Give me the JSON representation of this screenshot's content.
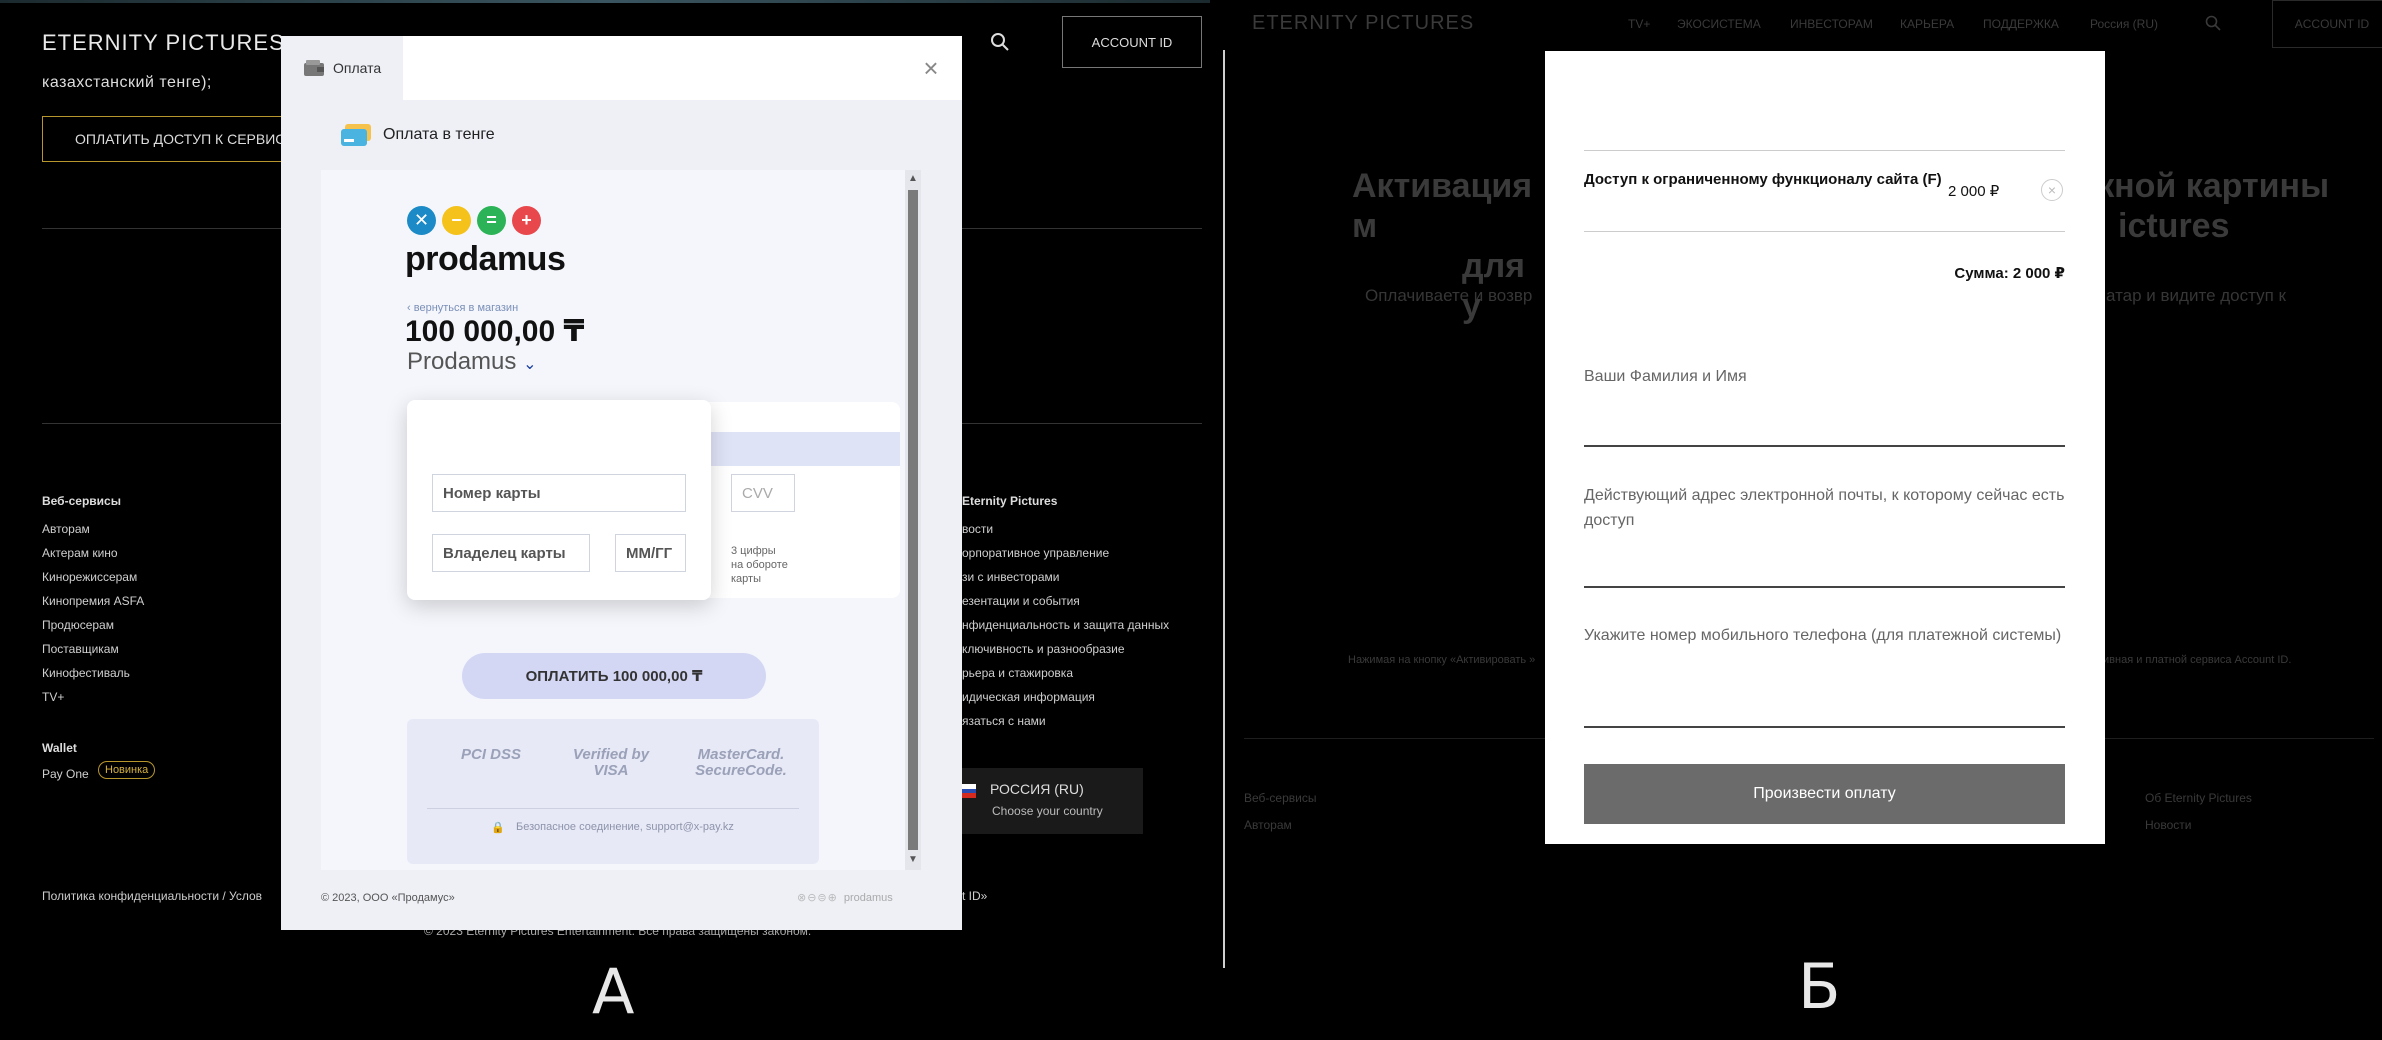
{
  "panel_a": {
    "site_logo": "ETERNITY PICTURES",
    "account_button": "ACCOUNT ID",
    "kzt_text": "казахстанский тенге);",
    "pay_access_button": "ОПЛАТИТЬ ДОСТУП К СЕРВИС",
    "footer": {
      "web_services_heading": "Веб-сервисы",
      "web_services": [
        "Авторам",
        "Актерам кино",
        "Кинорежиссерам",
        "Кинопремия ASFA",
        "Продюсерам",
        "Поставщикам",
        "Кинофестиваль",
        "TV+"
      ],
      "wallet_heading": "Wallet",
      "wallet_item": "Pay One",
      "wallet_badge": "Новинка",
      "about_heading": "Eternity Pictures",
      "about_links": [
        "вости",
        "орпоративное управление",
        "зи с инвесторами",
        "езентации и события",
        "нфиденциальность и защита данных",
        "ключивность и разнообразие",
        "рьера и стажировка",
        "идическая информация",
        "язаться с нами"
      ],
      "country_name": "РОССИЯ (RU)",
      "country_choose": "Choose your country",
      "policy": "Политика конфиденциальности   /   Услов",
      "policy_tail": "t ID»",
      "copyright": "© 2023 Eternity Pictures Entertainment. Все права защищены законом."
    },
    "letter": "А"
  },
  "modal_a": {
    "tab_label": "Оплата",
    "pay_in_tenge": "Оплата в тенге",
    "brand": "prodamus",
    "back_link": "вернуться в магазин",
    "amount": "100 000,00 ₸",
    "shop_name": "Prodamus",
    "card_number_placeholder": "Номер карты",
    "card_holder_placeholder": "Владелец карты",
    "expiry_placeholder": "ММ/ГГ",
    "cvv_placeholder": "CVV",
    "cvv_hint": [
      "3 цифры",
      "на обороте",
      "карты"
    ],
    "pay_button": "ОПЛАТИТЬ 100 000,00 ₸",
    "security_logos": [
      "PCI DSS",
      "Verified by VISA",
      "MasterCard. SecureCode."
    ],
    "secure_text": "Безопасное соединение, support@x-pay.kz",
    "footer_left": "© 2023, ООО «Продамус»",
    "footer_right": "prodamus"
  },
  "panel_b": {
    "site_logo": "ETERNITY PICTURES",
    "nav": [
      "TV+",
      "ЭКОСИСТЕМА",
      "ИНВЕСТОРАМ",
      "КАРЬЕРА",
      "ПОДДЕРЖКА",
      "Россия (RU)"
    ],
    "account_button": "ACCOUNT ID",
    "bg_title_left": [
      "Активация м",
      "для у"
    ],
    "bg_title_right": [
      "жной картины",
      "ictures"
    ],
    "bg_text_left": "Оплачиваете и возвр",
    "bg_text_right": "атар и видите доступ к",
    "bg_small_left": "Нажимая на кнопку «Активировать »",
    "bg_small_right": "тивная и платной сервиса Account ID.",
    "footer_web": "Веб-сервисы",
    "footer_authors": "Авторам",
    "footer_about": "Об Eternity Pictures",
    "footer_news": "Новости",
    "letter": "Б"
  },
  "modal_b": {
    "product": "Доступ к ограниченному функционалу сайта (F)",
    "price": "2 000 ₽",
    "total": "Сумма: 2 000 ₽",
    "name_label": "Ваши Фамилия и Имя",
    "email_label": "Действующий адрес электронной почты, к которому сейчас есть доступ",
    "phone_label": "Укажите номер мобильного телефона (для платежной системы)",
    "submit": "Произвести оплату"
  }
}
